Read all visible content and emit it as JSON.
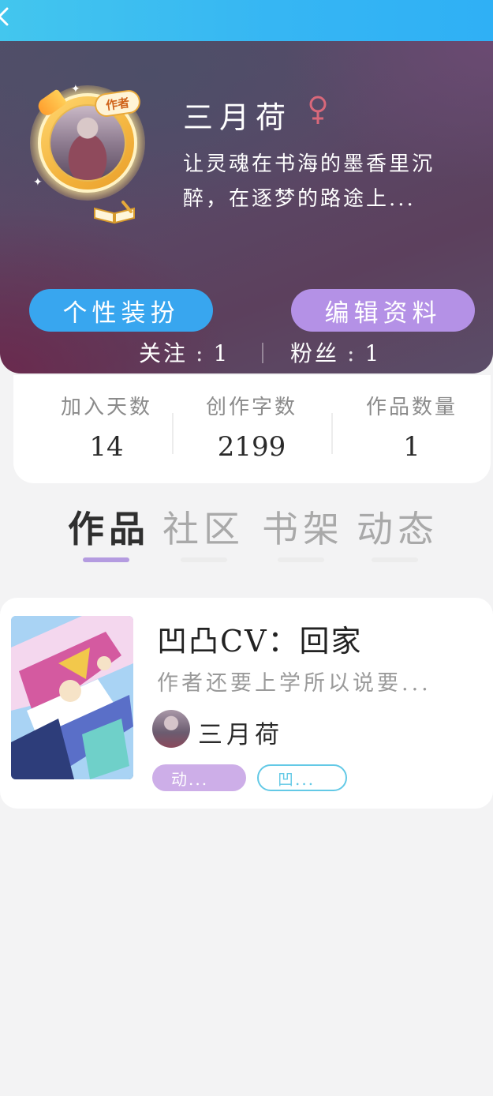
{
  "profile": {
    "name": "三月荷",
    "bio": "让灵魂在书海的墨香里沉醉，在逐梦的路途上...",
    "author_badge": "作者",
    "buttons": {
      "dress_up": "个性装扮",
      "edit_profile": "编辑资料"
    },
    "follow": {
      "label": "关注",
      "value": "1",
      "separator": ":"
    },
    "fans": {
      "label": "粉丝",
      "value": "1",
      "separator": ":"
    }
  },
  "stats": [
    {
      "label": "加入天数",
      "value": "14"
    },
    {
      "label": "创作字数",
      "value": "2199"
    },
    {
      "label": "作品数量",
      "value": "1"
    }
  ],
  "tabs": [
    {
      "label": "作品",
      "active": true
    },
    {
      "label": "社区",
      "active": false
    },
    {
      "label": "书架",
      "active": false
    },
    {
      "label": "动态",
      "active": false
    }
  ],
  "work": {
    "title": "凹凸CV：回家",
    "description": "作者还要上学所以说要...",
    "author": "三月荷",
    "tags": [
      "动...",
      "凹..."
    ]
  },
  "colors": {
    "top_bar": "#36b6f3",
    "dress_button": "#38a6ef",
    "edit_button": "#b491e6",
    "tab_indicator_active": "#b49be0",
    "tag_1": "#cdaee8",
    "tag_2_border": "#63c9e6"
  },
  "icons": {
    "back": "back-arrow-icon",
    "gender": "female-icon"
  }
}
